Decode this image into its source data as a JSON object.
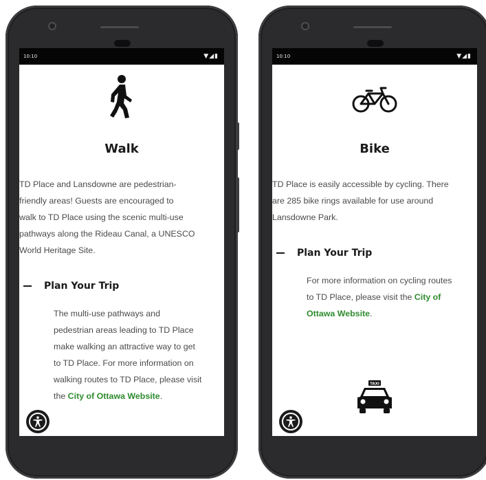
{
  "walk_phone": {
    "status_time": "10:10",
    "status_icons": "▼◢▮",
    "mode_icon": "pedestrian-walking-icon",
    "title": "Walk",
    "intro_lines": [
      "TD Place and Lansdowne are pedestrian-",
      "friendly areas! Guests are encouraged to",
      "walk to TD Place using the scenic multi-use",
      "pathways along the Rideau Canal, a UNESCO",
      "World Heritage Site."
    ],
    "plan_header": "Plan Your Trip",
    "plan_lines": [
      "The multi-use pathways and",
      "pedestrian areas leading to TD Place",
      "make walking an attractive way to get",
      "to TD Place. For more information on",
      "walking routes to TD Place, please visit"
    ],
    "plan_last_prefix": "the ",
    "plan_link": "City of Ottawa Website",
    "plan_suffix": ".",
    "accessibility_icon": "accessibility-icon"
  },
  "bike_phone": {
    "status_time": "10:10",
    "status_icons": "▼◢▮",
    "mode_icon": "bicycle-icon",
    "title": "Bike",
    "intro_lines": [
      "TD Place is easily accessible by cycling. There",
      "are 285 bike rings available for use around",
      "Lansdowne Park."
    ],
    "plan_header": "Plan Your Trip",
    "plan_lines": [
      "For more information on cycling routes"
    ],
    "plan_last_prefix": "to TD Place, please visit the ",
    "plan_link_part1": "City of",
    "plan_link_part2": "Ottawa Website",
    "plan_suffix": ".",
    "taxi_icon": "taxi-icon",
    "taxi_label": "TAXI",
    "accessibility_icon": "accessibility-icon"
  },
  "colors": {
    "link_green": "#2e8b2e",
    "phone_body": "#2b2b2d",
    "text_body": "#4a4a4a",
    "heading": "#1a1a1a"
  }
}
